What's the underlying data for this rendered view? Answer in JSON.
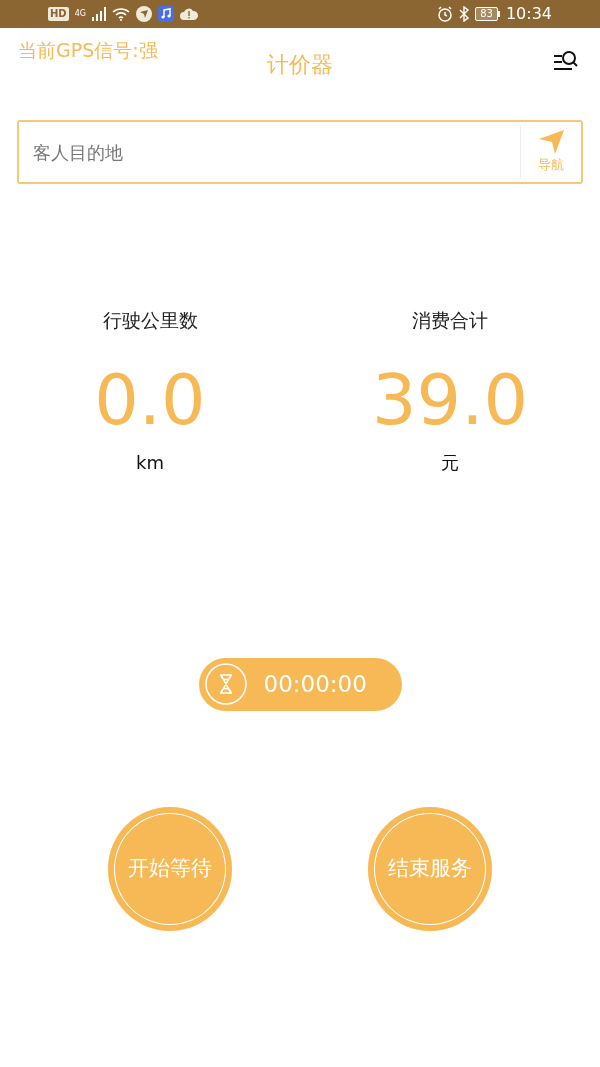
{
  "status_bar": {
    "left": [
      "HD",
      "4G"
    ],
    "battery": "83",
    "time": "10:34"
  },
  "header": {
    "gps_status": "当前GPS信号:强",
    "title": "计价器"
  },
  "destination": {
    "placeholder": "客人目的地",
    "nav_label": "导航"
  },
  "stats": [
    {
      "label": "行驶公里数",
      "value": "0.0",
      "unit": "km"
    },
    {
      "label": "消费合计",
      "value": "39.0",
      "unit": "元"
    }
  ],
  "timer": "00:00:00",
  "buttons": [
    "开始等待",
    "结束服务"
  ]
}
